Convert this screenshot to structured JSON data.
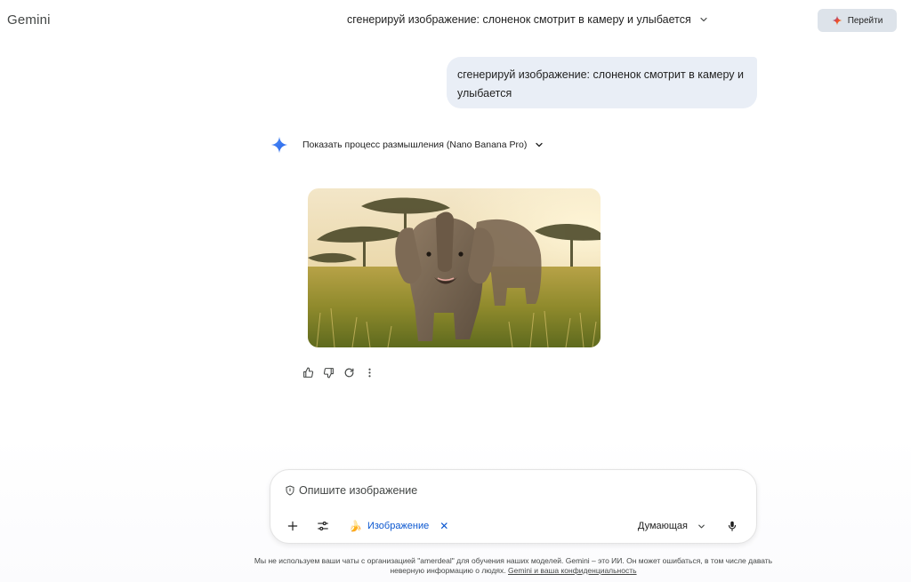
{
  "header": {
    "brand": "Gemini",
    "chat_title": "сгенерируй изображение: слоненок смотрит в камеру и улыбается",
    "go_button_label": "Перейти"
  },
  "conversation": {
    "user_message": "сгенерируй изображение: слоненок смотрит в камеру и улыбается",
    "thinking_toggle_label": "Показать процесс размышления (Nano Banana Pro)",
    "generated_image_alt": "слоненок смотрит в камеру и улыбается",
    "actions": [
      "thumbs-up-icon",
      "thumbs-down-icon",
      "refresh-icon",
      "more-vert-icon"
    ]
  },
  "composer": {
    "placeholder": "Опишите изображение",
    "tool_chip_label": "Изображение",
    "mode_label": "Думающая"
  },
  "footer": {
    "disclaimer_text": "Мы не используем ваши чаты с организацией \"amerdeal\" для обучения наших моделей. Gemini – это ИИ. Он может ошибаться, в том числе давать неверную информацию о людях.",
    "privacy_link": "Gemini и ваша конфиденциальность"
  },
  "colors": {
    "accent": "#0b57d0",
    "bubble": "#e9eef6",
    "go_button_bg": "#dde3ea"
  }
}
